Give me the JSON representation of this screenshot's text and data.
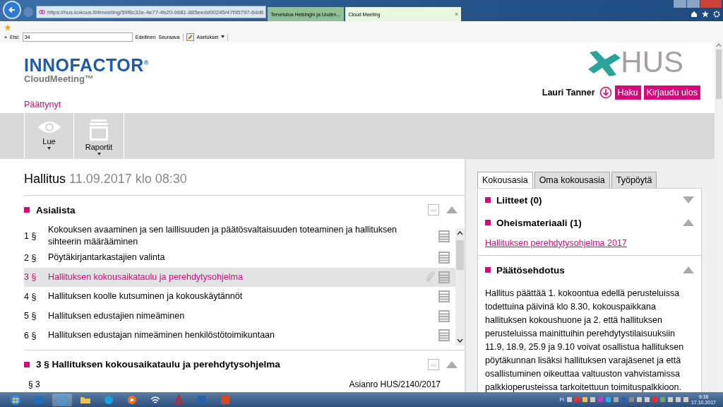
{
  "browser": {
    "url": "https://hus.kokous.fi/#meeting/59f8c32e-4e77-4b20-9681-885eedd00245/47f95797-6dd6",
    "tabs": [
      {
        "label": "Tervetuloa Helsingin ja Uuden...",
        "selected": false
      },
      {
        "label": "Cloud Meeting",
        "selected": true,
        "close": "×"
      }
    ],
    "find": {
      "close": "×",
      "label": "Etsi:",
      "value": "34",
      "buttons": [
        "Edellinen",
        "Seuraava"
      ],
      "options": "Asetukset"
    }
  },
  "header": {
    "brand": "INNOFACTOR$^{®}$",
    "product": "CloudMeeting™",
    "org_logo": "HUS",
    "status": "Päättynyt",
    "user": "Lauri Tanner",
    "buttons": [
      "Haku",
      "Kirjaudu ulos"
    ]
  },
  "toolbar": [
    {
      "label": "Lue",
      "kind": "eye"
    },
    {
      "label": "Raportit",
      "kind": "tray"
    }
  ],
  "meeting": {
    "title": "Hallitus",
    "datetime": "11.09.2017 klo 08:30"
  },
  "agenda": {
    "title": "Asialista",
    "items": [
      {
        "number": "1 §",
        "title": "Kokouksen avaaminen ja sen laillisuuden ja päätösvaltaisuuden toteaminen ja hallituksen sihteerin määrääminen",
        "selected": false,
        "attachment": false
      },
      {
        "number": "2 §",
        "title": "Pöytäkirjantarkastajien valinta",
        "selected": false,
        "attachment": false
      },
      {
        "number": "3 §",
        "title": "Hallituksen kokousaikataulu ja perehdytysohjelma",
        "selected": true,
        "attachment": true
      },
      {
        "number": "4 §",
        "title": "Hallituksen koolle kutsuminen ja kokouskäytännöt",
        "selected": false,
        "attachment": false
      },
      {
        "number": "5 §",
        "title": "Hallituksen edustajien nimeäminen",
        "selected": false,
        "attachment": false
      },
      {
        "number": "6 §",
        "title": "Hallituksen edustajan nimeäminen henkilöstötoimikuntaan",
        "selected": false,
        "attachment": false
      }
    ]
  },
  "section": {
    "title": "3 § Hallituksen kokousaikataulu ja perehdytysohjelma",
    "number": "§ 3",
    "case_number": "Asianro HUS/2140/2017"
  },
  "side": {
    "tabs": [
      {
        "label": "Kokousasia",
        "selected": true
      },
      {
        "label": "Oma kokousasia",
        "selected": false
      },
      {
        "label": "Työpöytä",
        "selected": false
      }
    ],
    "panels": [
      {
        "title": "Liitteet (0)",
        "expanded": false
      },
      {
        "title": "Oheismateriaali (1)",
        "expanded": true,
        "links": [
          "Hallituksen perehdytysohjelma 2017"
        ]
      },
      {
        "title": "Päätösehdotus",
        "expanded": true,
        "text": "Hallitus päättää 1. kokoontua edellä perusteluissa todettuina päivinä klo 8.30, kokouspaikkana hallituksen kokoushuone ja 2. että hallituksen perusteluissa mainittuihin perehdytystilaisuuksiin 11.9, 18.9, 25.9 ja 9.10 voivat osallistua hallituksen pöytäkunnan lisäksi hallituksen varajäsenet ja että osallistuminen oikeuttaa valtuuston vahvistamissa palkkioperusteissa tarkoitettuun toimituspalkkioon."
      }
    ]
  },
  "taskbar": {
    "language": "FI",
    "time": "9:36",
    "date": "17.10.2017"
  }
}
